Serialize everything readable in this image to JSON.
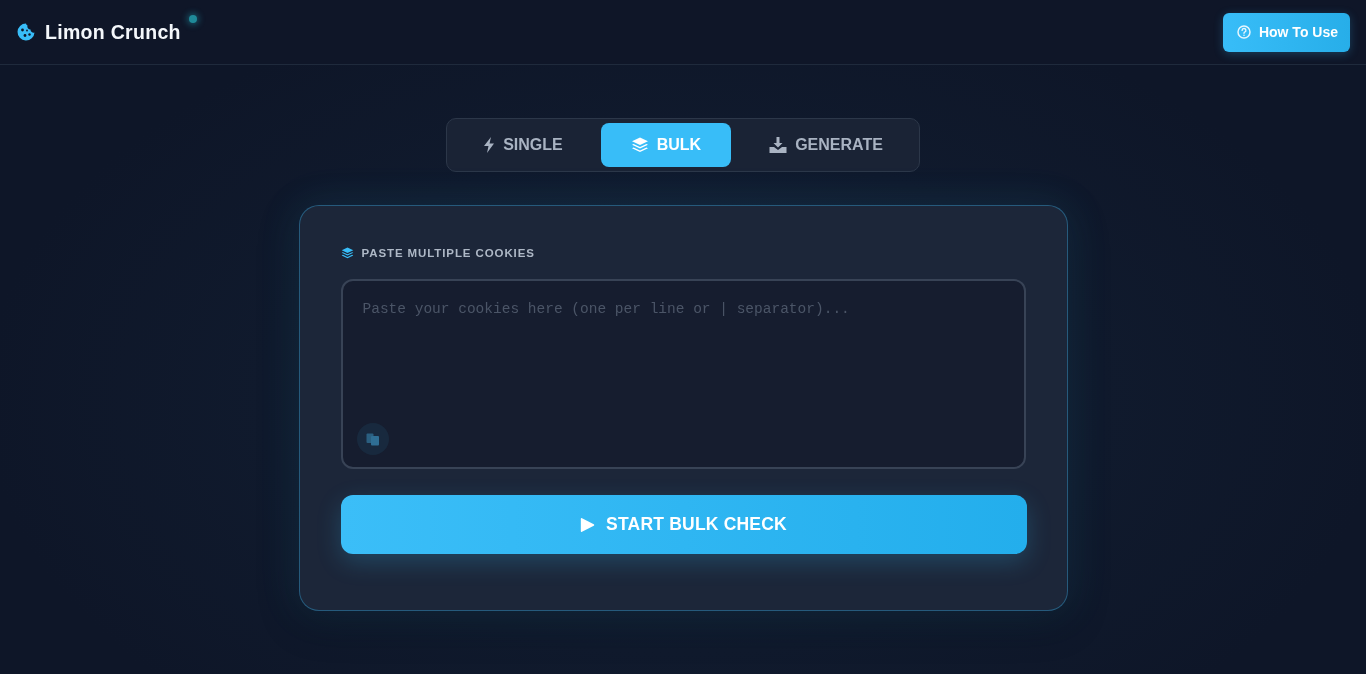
{
  "header": {
    "title": "Limon Crunch",
    "help_button": "How To Use"
  },
  "tabs": [
    {
      "label": "SINGLE",
      "selected": false
    },
    {
      "label": "BULK",
      "selected": true
    },
    {
      "label": "GENERATE",
      "selected": false
    }
  ],
  "panel": {
    "label": "PASTE MULTIPLE COOKIES",
    "input": {
      "placeholder": "Paste your cookies here (one per line or | separator)..."
    },
    "submit_button": "START BULK CHECK"
  }
}
